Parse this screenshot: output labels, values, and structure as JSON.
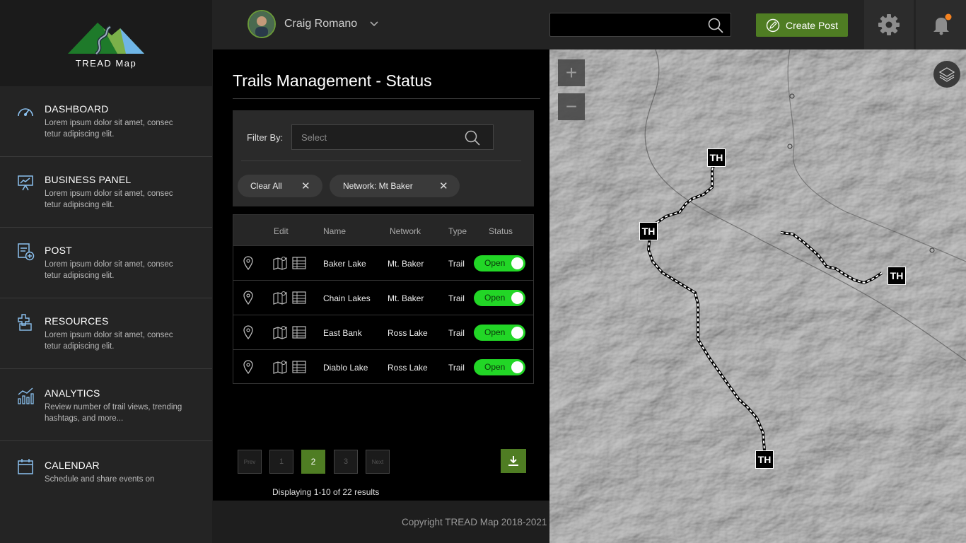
{
  "brand": {
    "name": "TREAD Map"
  },
  "sidebar": {
    "items": [
      {
        "title": "DASHBOARD",
        "desc": "Lorem ipsum dolor sit amet, consec tetur adipiscing elit.",
        "icon": "speedometer-icon"
      },
      {
        "title": "BUSINESS PANEL",
        "desc": "Lorem ipsum dolor sit amet, consec tetur adipiscing elit.",
        "icon": "presentation-chart-icon"
      },
      {
        "title": "POST",
        "desc": "Lorem ipsum dolor sit amet, consec tetur adipiscing elit.",
        "icon": "post-add-icon"
      },
      {
        "title": "RESOURCES",
        "desc": "Lorem ipsum dolor sit amet, consec tetur adipiscing elit.",
        "icon": "resources-icon"
      },
      {
        "title": "ANALYTICS",
        "desc": "Review number of trail views, trending hashtags, and more...",
        "icon": "analytics-chart-icon"
      },
      {
        "title": "CALENDAR",
        "desc": "Schedule and share events on",
        "icon": "calendar-icon"
      }
    ]
  },
  "header": {
    "user_name": "Craig Romano",
    "search": {
      "value": "",
      "placeholder": ""
    },
    "create_post_label": "Create Post",
    "notification_dot_color": "#f58220"
  },
  "main": {
    "title": "Trails Management - Status",
    "filter": {
      "label": "Filter By:",
      "select_placeholder": "Select",
      "chips": [
        "Clear All",
        "Network: Mt Baker"
      ]
    },
    "table": {
      "headers": {
        "edit": "Edit",
        "name": "Name",
        "network": "Network",
        "type": "Type",
        "status": "Status"
      },
      "rows": [
        {
          "name": "Baker Lake",
          "network": "Mt. Baker",
          "type": "Trail",
          "status": "Open"
        },
        {
          "name": "Chain Lakes",
          "network": "Mt. Baker",
          "type": "Trail",
          "status": "Open"
        },
        {
          "name": "East Bank",
          "network": "Ross Lake",
          "type": "Trail",
          "status": "Open"
        },
        {
          "name": "Diablo Lake",
          "network": "Ross Lake",
          "type": "Trail",
          "status": "Open"
        }
      ]
    },
    "pagination": {
      "prev": "Prev",
      "pages": [
        "1",
        "2",
        "3"
      ],
      "current": "2",
      "next": "Next",
      "results_text": "Displaying 1-10 of 22 results"
    }
  },
  "footer": {
    "copyright": "Copyright TREAD Map 2018-2021"
  },
  "map": {
    "marker_label": "TH",
    "zoom_in": "+",
    "zoom_out": "−"
  },
  "colors": {
    "accent_green": "#4f7d23",
    "toggle_green": "#22d626",
    "panel_dark": "#2a2a2a"
  }
}
